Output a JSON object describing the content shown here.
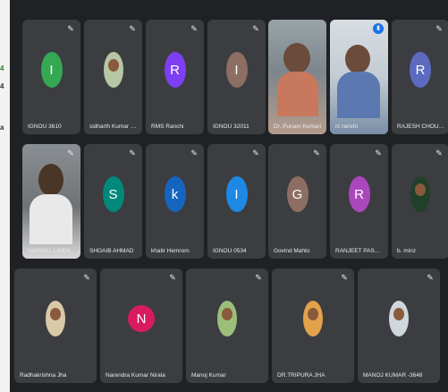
{
  "left_strip": {
    "text1": "4",
    "text2": "4",
    "text3": "a"
  },
  "colors": {
    "tile": "#3b3d41",
    "background": "#1f2125",
    "speaking_border": "#8ab4f8"
  },
  "participants": [
    {
      "name": "IGNOU 3610",
      "initial": "I",
      "avatar_color": "#34a853"
    },
    {
      "name": "sidharth Kumar singh",
      "initial": "",
      "avatar_color": ""
    },
    {
      "name": "RMS Ranchi",
      "initial": "R",
      "avatar_color": "#7e3ff2"
    },
    {
      "name": "IGNOU 32011",
      "initial": "I",
      "avatar_color": "#8d6e63"
    },
    {
      "name": "Dr. Punam Kumari",
      "initial": "",
      "avatar_color": ""
    },
    {
      "name": "rc ranchi",
      "initial": "",
      "avatar_color": ""
    },
    {
      "name": "RAJESH CHOUDHARY",
      "initial": "R",
      "avatar_color": "#5c6bc0"
    },
    {
      "name": "NARMAL LINDA",
      "initial": "",
      "avatar_color": ""
    },
    {
      "name": "SHOAIB AHMAD",
      "initial": "S",
      "avatar_color": "#00897b"
    },
    {
      "name": "khatir Hemrom",
      "initial": "k",
      "avatar_color": "#1565c0"
    },
    {
      "name": "IGNOU 0534",
      "initial": "I",
      "avatar_color": "#1e88e5"
    },
    {
      "name": "Govind Mahto",
      "initial": "G",
      "avatar_color": "#8d6e63"
    },
    {
      "name": "RANJEET PASWAN",
      "initial": "R",
      "avatar_color": "#ab47bc"
    },
    {
      "name": "b. minz",
      "initial": "",
      "avatar_color": ""
    },
    {
      "name": "Radhakrishna Jha",
      "initial": "",
      "avatar_color": ""
    },
    {
      "name": "Narendra Kumar Nirala",
      "initial": "N",
      "avatar_color": "#d81b60"
    },
    {
      "name": "Manoj Kumar",
      "initial": "",
      "avatar_color": ""
    },
    {
      "name": "DR.TRIPURA JHA",
      "initial": "",
      "avatar_color": ""
    },
    {
      "name": "MANOJ KUMAR -3648",
      "initial": "",
      "avatar_color": ""
    }
  ]
}
